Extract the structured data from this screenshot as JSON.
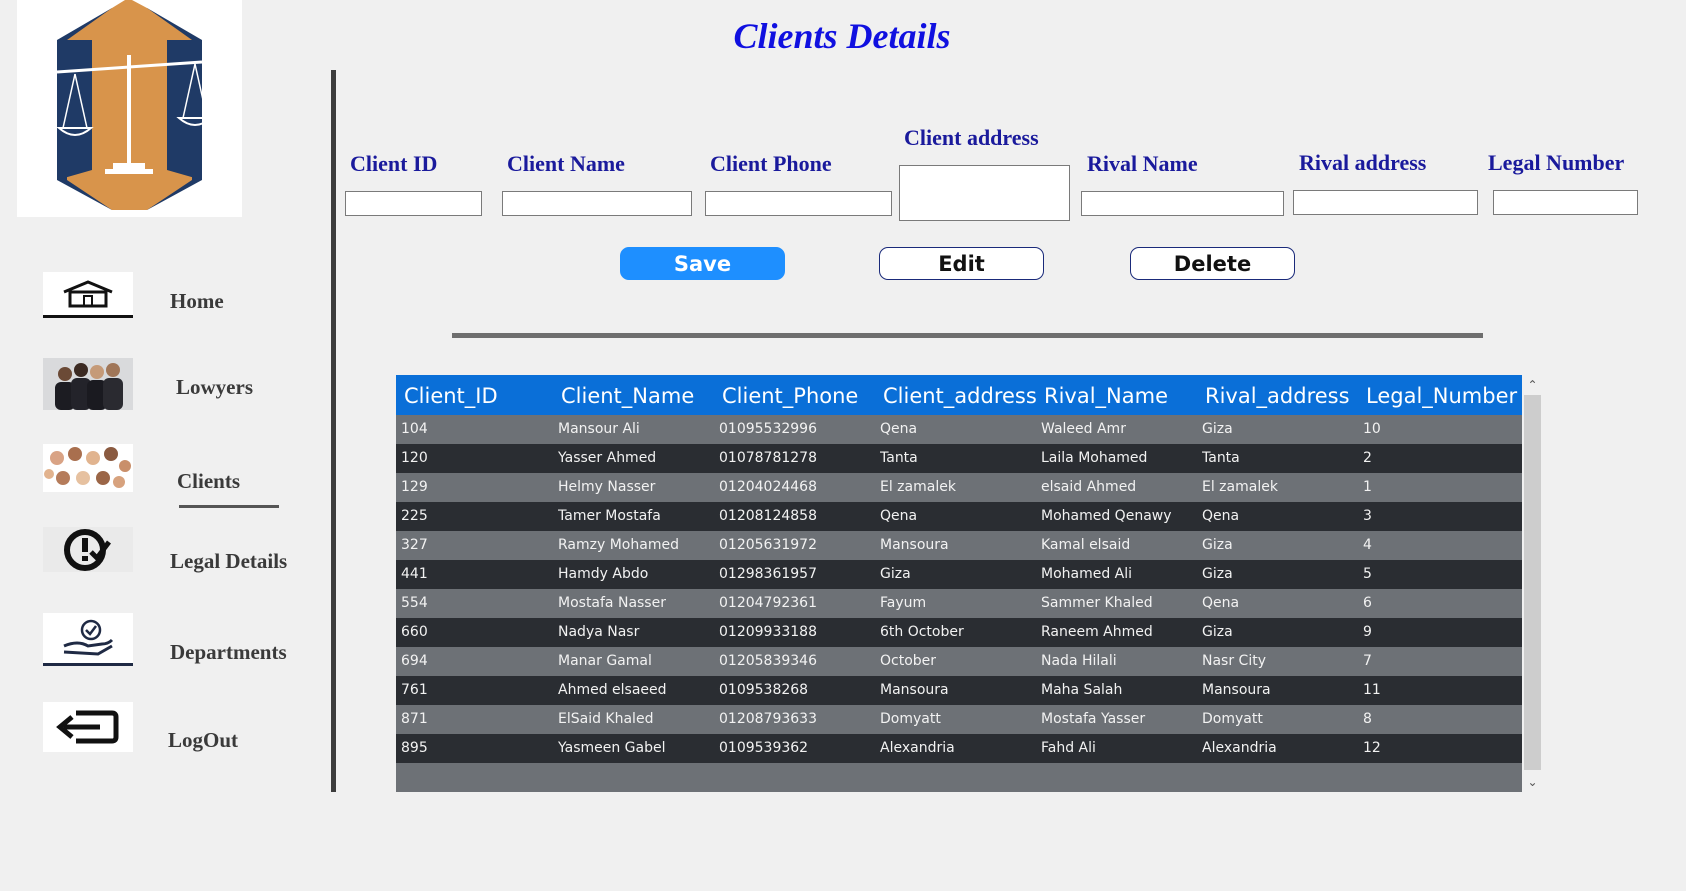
{
  "page": {
    "title": "Clients Details"
  },
  "sidebar": {
    "items": [
      {
        "label": "Home",
        "icon": "home-icon"
      },
      {
        "label": "Lowyers",
        "icon": "lawyers-photo-icon"
      },
      {
        "label": "Clients",
        "icon": "clients-photo-icon"
      },
      {
        "label": "Legal Details",
        "icon": "legal-check-icon"
      },
      {
        "label": "Departments",
        "icon": "departments-hand-icon"
      },
      {
        "label": "LogOut",
        "icon": "logout-icon"
      }
    ],
    "active": "Clients"
  },
  "form": {
    "client_id_label": "Client ID",
    "client_name_label": "Client Name",
    "client_phone_label": "Client Phone",
    "client_address_label": "Client address",
    "rival_name_label": "Rival Name",
    "rival_address_label": "Rival address",
    "legal_number_label": "Legal Number",
    "client_id_value": "",
    "client_name_value": "",
    "client_phone_value": "",
    "client_address_value": "",
    "rival_name_value": "",
    "rival_address_value": "",
    "legal_number_value": ""
  },
  "buttons": {
    "save": "Save",
    "edit": "Edit",
    "delete": "Delete"
  },
  "colors": {
    "title": "#1010e0",
    "form_label": "#1a1a9c",
    "save_button": "#1e8fff",
    "grid_header": "#0a6fd8",
    "grid_row_light": "#6d7176",
    "grid_row_dark": "#2a2d32"
  },
  "grid": {
    "columns": [
      "Client_ID",
      "Client_Name",
      "Client_Phone",
      "Client_address",
      "Rival_Name",
      "Rival_address",
      "Legal_Number"
    ],
    "rows": [
      [
        "104",
        "Mansour Ali",
        "01095532996",
        "Qena",
        "Waleed Amr",
        "Giza",
        "10"
      ],
      [
        "120",
        "Yasser Ahmed",
        "01078781278",
        "Tanta",
        "Laila Mohamed",
        "Tanta",
        "2"
      ],
      [
        "129",
        "Helmy Nasser",
        "01204024468",
        "El zamalek",
        "elsaid Ahmed",
        "El zamalek",
        "1"
      ],
      [
        "225",
        "Tamer Mostafa",
        "01208124858",
        "Qena",
        "Mohamed Qenawy",
        "Qena",
        "3"
      ],
      [
        "327",
        "Ramzy Mohamed",
        "01205631972",
        "Mansoura",
        "Kamal elsaid",
        "Giza",
        "4"
      ],
      [
        "441",
        "Hamdy Abdo",
        "01298361957",
        "Giza",
        "Mohamed Ali",
        "Giza",
        "5"
      ],
      [
        "554",
        "Mostafa Nasser",
        "01204792361",
        "Fayum",
        "Sammer Khaled",
        "Qena",
        "6"
      ],
      [
        "660",
        "Nadya Nasr",
        "01209933188",
        "6th October",
        "Raneem Ahmed",
        "Giza",
        "9"
      ],
      [
        "694",
        "Manar Gamal",
        "01205839346",
        "October",
        "Nada Hilali",
        "Nasr City",
        "7"
      ],
      [
        "761",
        "Ahmed elsaeed",
        "0109538268",
        "Mansoura",
        "Maha Salah",
        "Mansoura",
        "11"
      ],
      [
        "871",
        "ElSaid Khaled",
        "01208793633",
        "Domyatt",
        "Mostafa Yasser",
        "Domyatt",
        "8"
      ],
      [
        "895",
        "Yasmeen Gabel",
        "0109539362",
        "Alexandria",
        "Fahd Ali",
        "Alexandria",
        "12"
      ]
    ]
  }
}
